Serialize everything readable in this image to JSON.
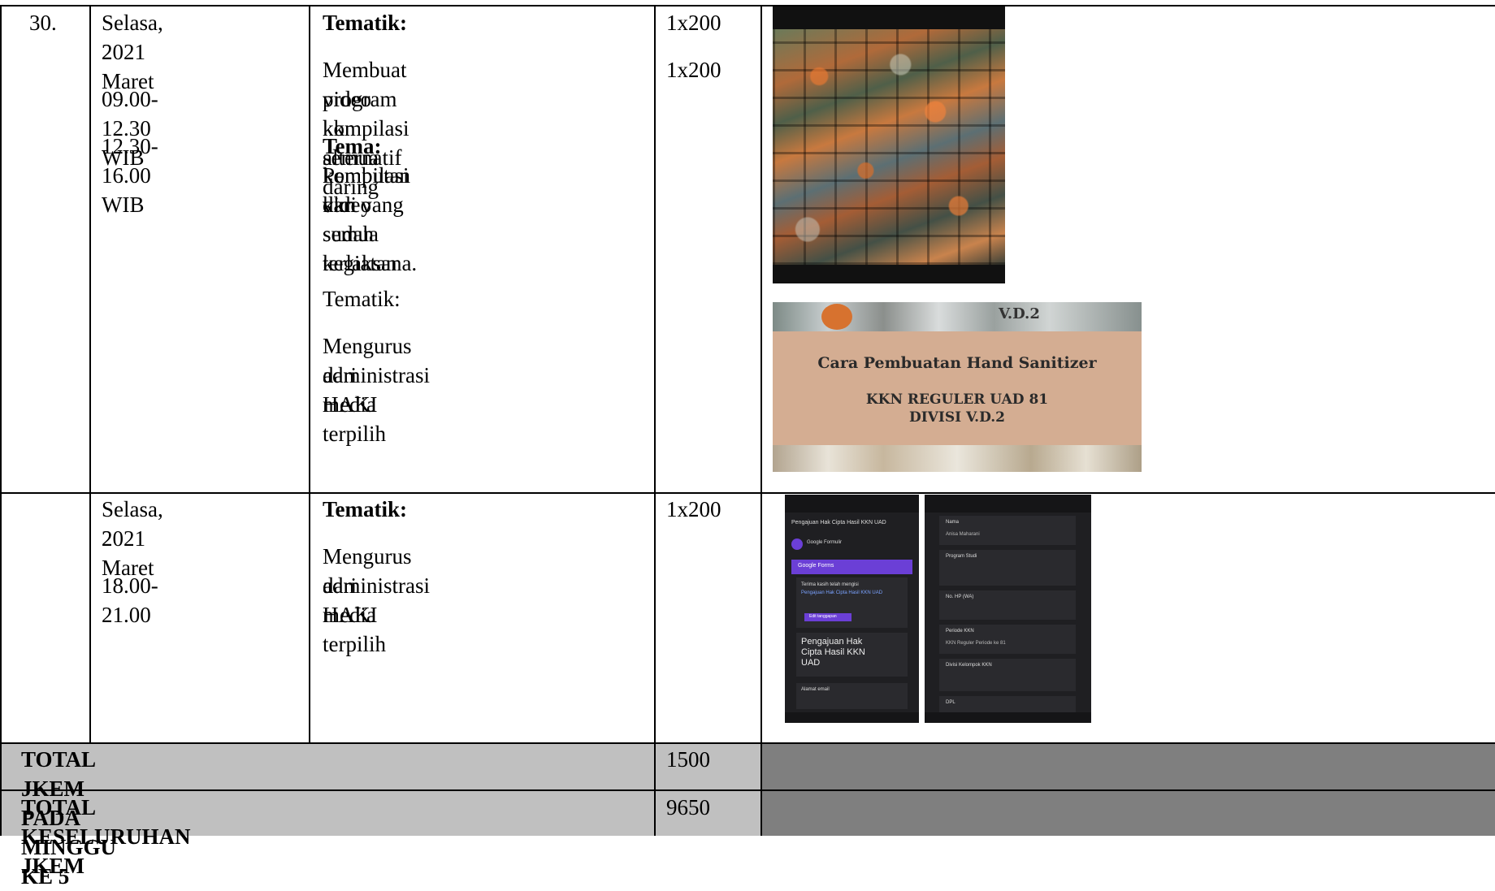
{
  "rows": [
    {
      "no": "30.",
      "day_line1": "Selasa, 2 Maret",
      "day_line2": "2021",
      "time1": "09.00-12.30 WIB",
      "time2": "12.30-16.00 WIB",
      "act1_heading": "Tematik:",
      "act1_desc_l1": "Membuat video kompilasi semua",
      "act1_desc_l2": "program kkn alternatif daring",
      "tema_label": "Tema:",
      "tema_l1": "Pembutan video",
      "tema_l2": "kompilasi dari semua kegiatan",
      "tema_l3": "kkn yang sudah terlaksana.",
      "act2_heading": "Tematik:",
      "act2_desc_l1": "Mengurus administrasi HAKI",
      "act2_desc_l2": "dari media terpilih",
      "jkem1": "1x200",
      "jkem2": "1x200"
    },
    {
      "no": "",
      "day_line1": "Selasa, 2 Maret",
      "day_line2": "2021",
      "time1": "18.00-21.00",
      "act_heading": "Tematik:",
      "act_desc_l1": "Mengurus administrasi HAKI",
      "act_desc_l2": "dari media terpilih",
      "jkem": "1x200"
    }
  ],
  "banner": {
    "corner_label": "V.D.2",
    "title": "Cara Pembuatan Hand Sanitizer",
    "line2": "KKN REGULER UAD 81",
    "line3": "DIVISI V.D.2"
  },
  "form_screenshot": {
    "left_header": "Pengajuan Hak Cipta Hasil KKN UAD",
    "left_sender": "Google Formulir",
    "left_bar": "Google Forms",
    "left_thanks": "Terima kasih telah mengisi",
    "left_link": "Pengajuan Hak Cipta Hasil KKN UAD",
    "left_button": "Edit tanggapan",
    "left_big_title": "Pengajuan Hak Cipta Hasil KKN UAD",
    "left_field": "Alamat email",
    "right_field1": "Nama",
    "right_value1": "Anisa Maharani",
    "right_field2": "Program Studi",
    "right_field3": "No. HP (WA)",
    "right_field4": "Periode KKN",
    "right_value4": "KKN Reguler Periode ke 81",
    "right_field5": "Divisi Kelompok KKN",
    "right_field6": "DPL"
  },
  "totals": [
    {
      "label": "TOTAL JKEM PADA MINGGU KE 5",
      "value": "1500"
    },
    {
      "label": "TOTAL KESELURUHAN JKEM",
      "value": "9650"
    }
  ],
  "colors": {
    "total_label_bg": "#c0c0c0",
    "total_value_bg": "#c0c0c0",
    "total_right_bg": "#7f7f7f",
    "banner_bg": "#d4ad92",
    "form_bar": "#6b3fd6"
  }
}
